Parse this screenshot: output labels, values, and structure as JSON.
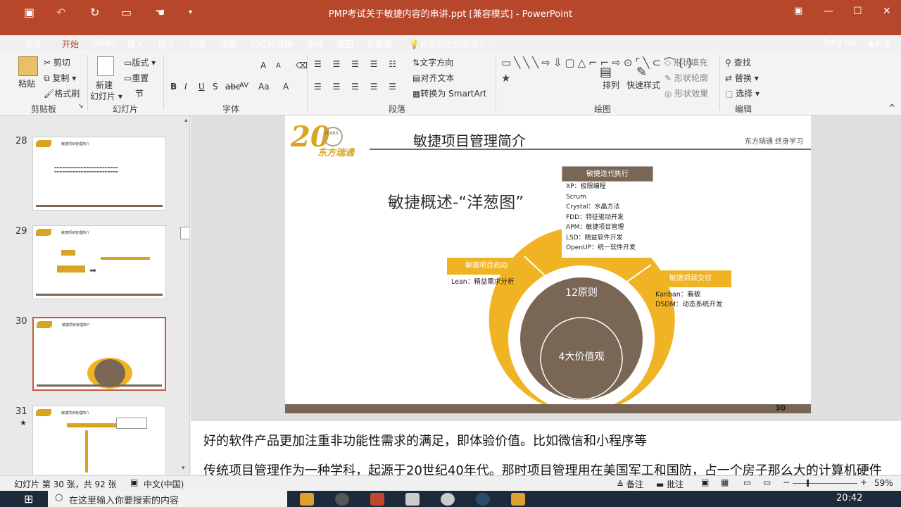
{
  "window": {
    "title": "PMP考试关于敏捷内容的串讲.ppt [兼容模式] - PowerPoint",
    "user": "Tong Liu",
    "share": "共享"
  },
  "menu": {
    "tabs": [
      "文件",
      "开始",
      "iSlide",
      "插入",
      "设计",
      "切换",
      "动画",
      "幻灯片放映",
      "审阅",
      "视图",
      "加载项"
    ],
    "active": "开始",
    "tellme": "告诉我您想要做什么..."
  },
  "ribbon": {
    "clipboard": {
      "paste": "粘贴",
      "cut": "剪切",
      "copy": "复制",
      "format_painter": "格式刷",
      "group": "剪贴板"
    },
    "slides": {
      "new_slide": "新建",
      "new_slide2": "幻灯片",
      "layout": "版式",
      "reset": "重置",
      "section": "节",
      "group": "幻灯片"
    },
    "font": {
      "group": "字体",
      "bold": "B",
      "italic": "I",
      "underline": "U",
      "strike": "S",
      "spacing": "AV",
      "case": "Aa",
      "grow": "A",
      "shrink": "A",
      "color": "A"
    },
    "paragraph": {
      "group": "段落",
      "text_direction": "文字方向",
      "align_text": "对齐文本",
      "smartart": "转换为 SmartArt"
    },
    "drawing": {
      "group": "绘图",
      "arrange": "排列",
      "quick_styles": "快速样式",
      "shape_fill": "形状填充",
      "shape_outline": "形状轮廓",
      "shape_effects": "形状效果"
    },
    "editing": {
      "group": "编辑",
      "find": "查找",
      "replace": "替换",
      "select": "选择"
    }
  },
  "thumbnails": [
    {
      "num": "28",
      "title": "敏捷项目管理简介",
      "selected": false
    },
    {
      "num": "29",
      "title": "敏捷项目管理简介",
      "selected": false
    },
    {
      "num": "30",
      "title": "敏捷项目管理简介",
      "selected": true
    },
    {
      "num": "31",
      "title": "敏捷项目管理简介",
      "selected": false,
      "star": "★"
    }
  ],
  "slide": {
    "title": "敏捷项目管理简介",
    "brand": "东方瑞通",
    "tagline": "东方瑞通  终身学习",
    "logo_text": "YEARS",
    "heading": "敏捷概述-“洋葱图”",
    "center_outer": "12原则",
    "center_inner": "4大价值观",
    "box_top": {
      "title": "敏捷迭代执行",
      "items": [
        "XP：极限编程",
        "Scrum",
        "Crystal：水晶方法",
        "FDD：特征驱动开发",
        "APM：敏捷项目管理",
        "LSD：精益软件开发",
        "OpenUP：统一软件开发"
      ]
    },
    "box_left": {
      "title": "敏捷项目启动",
      "items": [
        "Lean：精益需求分析"
      ]
    },
    "box_right": {
      "title": "敏捷项目交付",
      "items": [
        "Kanban：看板",
        "DSDM：动态系统开发"
      ]
    },
    "page_num": "30"
  },
  "notes": [
    "好的软件产品更加注重非功能性需求的满足，即体验价值。比如微信和小程序等",
    "传统项目管理作为一种学科，起源于20世纪40年代。那时项目管理用在美国军工和国防，占一个房子那么大的计算机硬件"
  ],
  "status": {
    "slide_info": "幻灯片 第 30 张，共 92 张",
    "language": "中文(中国)",
    "notes": "备注",
    "comments": "批注",
    "zoom": "59%"
  },
  "taskbar": {
    "search_placeholder": "在这里输入你要搜索的内容",
    "time": "20:42"
  },
  "colors": {
    "ribbon_red": "#b7472a",
    "gold": "#f0b323",
    "brown": "#7a6655"
  }
}
